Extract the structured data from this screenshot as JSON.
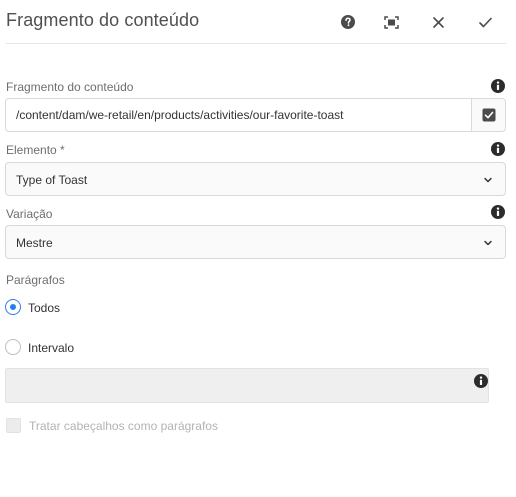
{
  "header": {
    "title": "Fragmento do conteúdo",
    "help_icon": "help-circle-icon",
    "fullscreen_icon": "fullscreen-icon",
    "close_icon": "close-icon",
    "done_icon": "checkmark-icon"
  },
  "fields": {
    "fragment": {
      "label": "Fragmento do conteúdo",
      "value": "/content/dam/we-retail/en/products/activities/our-favorite-toast",
      "browse_icon": "picker-icon"
    },
    "element": {
      "label": "Elemento *",
      "value": "Type of Toast"
    },
    "variation": {
      "label": "Variação",
      "value": "Mestre"
    },
    "paragraphs": {
      "label": "Parágrafos",
      "options": [
        {
          "label": "Todos",
          "selected": true
        },
        {
          "label": "Intervalo",
          "selected": false
        }
      ],
      "range_value": ""
    },
    "headers_as_paragraphs": {
      "label": "Tratar cabeçalhos como parágrafos",
      "checked": false,
      "disabled": true
    }
  },
  "colors": {
    "accent": "#2680eb",
    "text": "#4b4b4b",
    "icon": "#4b4b4b",
    "disabled_bg": "#efefef"
  }
}
